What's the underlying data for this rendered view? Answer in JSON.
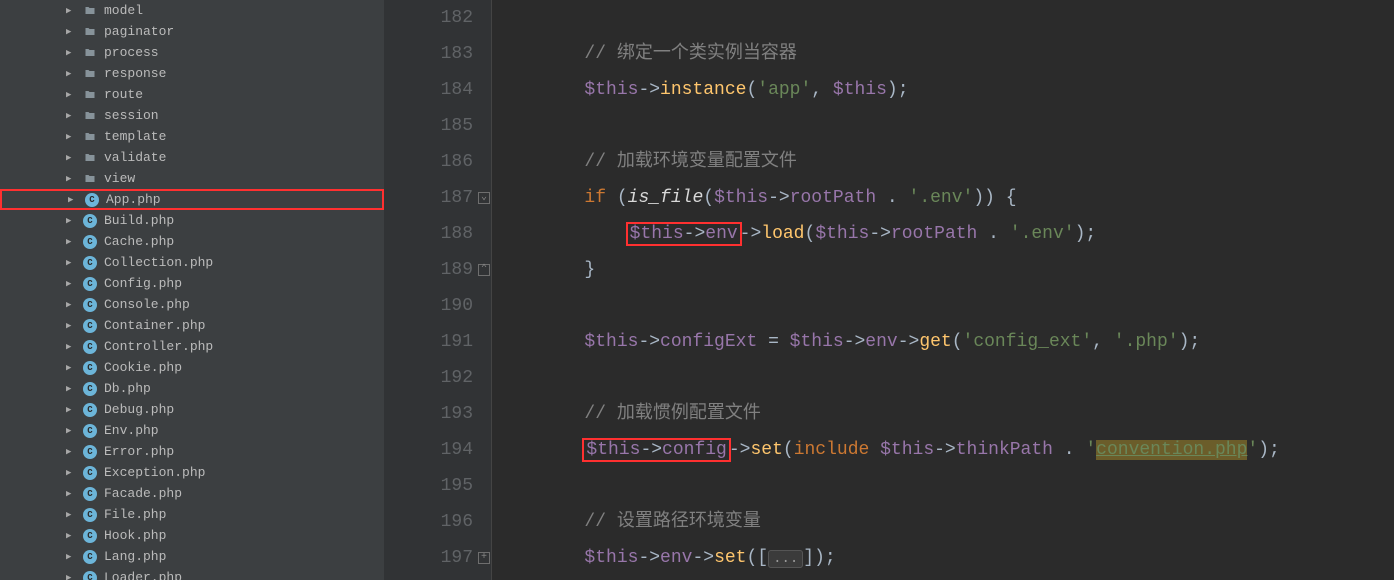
{
  "sidebar": {
    "items": [
      {
        "kind": "folder",
        "label": "model",
        "highlight": false
      },
      {
        "kind": "folder",
        "label": "paginator",
        "highlight": false
      },
      {
        "kind": "folder",
        "label": "process",
        "highlight": false
      },
      {
        "kind": "folder",
        "label": "response",
        "highlight": false
      },
      {
        "kind": "folder",
        "label": "route",
        "highlight": false
      },
      {
        "kind": "folder",
        "label": "session",
        "highlight": false
      },
      {
        "kind": "folder",
        "label": "template",
        "highlight": false
      },
      {
        "kind": "folder",
        "label": "validate",
        "highlight": false
      },
      {
        "kind": "folder",
        "label": "view",
        "highlight": false
      },
      {
        "kind": "php",
        "label": "App.php",
        "highlight": true
      },
      {
        "kind": "php",
        "label": "Build.php",
        "highlight": false
      },
      {
        "kind": "php",
        "label": "Cache.php",
        "highlight": false
      },
      {
        "kind": "php",
        "label": "Collection.php",
        "highlight": false
      },
      {
        "kind": "php",
        "label": "Config.php",
        "highlight": false
      },
      {
        "kind": "php",
        "label": "Console.php",
        "highlight": false
      },
      {
        "kind": "php",
        "label": "Container.php",
        "highlight": false
      },
      {
        "kind": "php",
        "label": "Controller.php",
        "highlight": false
      },
      {
        "kind": "php",
        "label": "Cookie.php",
        "highlight": false
      },
      {
        "kind": "php",
        "label": "Db.php",
        "highlight": false
      },
      {
        "kind": "php",
        "label": "Debug.php",
        "highlight": false
      },
      {
        "kind": "php",
        "label": "Env.php",
        "highlight": false
      },
      {
        "kind": "php",
        "label": "Error.php",
        "highlight": false
      },
      {
        "kind": "php",
        "label": "Exception.php",
        "highlight": false
      },
      {
        "kind": "php",
        "label": "Facade.php",
        "highlight": false
      },
      {
        "kind": "php",
        "label": "File.php",
        "highlight": false
      },
      {
        "kind": "php",
        "label": "Hook.php",
        "highlight": false
      },
      {
        "kind": "php",
        "label": "Lang.php",
        "highlight": false
      },
      {
        "kind": "php",
        "label": "Loader.php",
        "highlight": false
      }
    ]
  },
  "editor": {
    "firstLine": 182,
    "lineNumbers": [
      "182",
      "183",
      "184",
      "185",
      "186",
      "187",
      "188",
      "189",
      "190",
      "191",
      "192",
      "193",
      "194",
      "195",
      "196",
      "197"
    ],
    "foldMarks": {
      "187": "top",
      "189": "bottom",
      "197": "plus"
    },
    "lines": [
      [],
      [
        {
          "cls": "cm",
          "text": "// 绑定一个类实例当容器"
        }
      ],
      [
        {
          "cls": "var",
          "text": "$this"
        },
        {
          "cls": "op",
          "text": "->"
        },
        {
          "cls": "mth",
          "text": "instance"
        },
        {
          "cls": "op",
          "text": "("
        },
        {
          "cls": "str",
          "text": "'app'"
        },
        {
          "cls": "op",
          "text": ", "
        },
        {
          "cls": "var",
          "text": "$this"
        },
        {
          "cls": "op",
          "text": ");"
        }
      ],
      [],
      [
        {
          "cls": "cm",
          "text": "// 加载环境变量配置文件"
        }
      ],
      [
        {
          "cls": "kw",
          "text": "if "
        },
        {
          "cls": "op",
          "text": "("
        },
        {
          "cls": "fnit",
          "text": "is_file"
        },
        {
          "cls": "op",
          "text": "("
        },
        {
          "cls": "var",
          "text": "$this"
        },
        {
          "cls": "op",
          "text": "->"
        },
        {
          "cls": "prop",
          "text": "rootPath"
        },
        {
          "cls": "op",
          "text": " . "
        },
        {
          "cls": "str",
          "text": "'.env'"
        },
        {
          "cls": "op",
          "text": ")) {"
        }
      ],
      [
        {
          "cls": "op",
          "text": "    "
        },
        {
          "redstart": true
        },
        {
          "cls": "var",
          "text": "$this"
        },
        {
          "cls": "op",
          "text": "->"
        },
        {
          "cls": "prop",
          "text": "env"
        },
        {
          "redend": true
        },
        {
          "cls": "op",
          "text": "->"
        },
        {
          "cls": "mth",
          "text": "load"
        },
        {
          "cls": "op",
          "text": "("
        },
        {
          "cls": "var",
          "text": "$this"
        },
        {
          "cls": "op",
          "text": "->"
        },
        {
          "cls": "prop",
          "text": "rootPath"
        },
        {
          "cls": "op",
          "text": " . "
        },
        {
          "cls": "str",
          "text": "'.env'"
        },
        {
          "cls": "op",
          "text": ");"
        }
      ],
      [
        {
          "cls": "op",
          "text": "}"
        }
      ],
      [],
      [
        {
          "cls": "var",
          "text": "$this"
        },
        {
          "cls": "op",
          "text": "->"
        },
        {
          "cls": "prop",
          "text": "configExt"
        },
        {
          "cls": "op",
          "text": " = "
        },
        {
          "cls": "var",
          "text": "$this"
        },
        {
          "cls": "op",
          "text": "->"
        },
        {
          "cls": "prop",
          "text": "env"
        },
        {
          "cls": "op",
          "text": "->"
        },
        {
          "cls": "mth",
          "text": "get"
        },
        {
          "cls": "op",
          "text": "("
        },
        {
          "cls": "str",
          "text": "'config_ext'"
        },
        {
          "cls": "op",
          "text": ", "
        },
        {
          "cls": "str",
          "text": "'.php'"
        },
        {
          "cls": "op",
          "text": ");"
        }
      ],
      [],
      [
        {
          "cls": "cm",
          "text": "// 加载惯例配置文件"
        }
      ],
      [
        {
          "redstart": true
        },
        {
          "cls": "var",
          "text": "$this"
        },
        {
          "cls": "op",
          "text": "->"
        },
        {
          "cls": "prop",
          "text": "config"
        },
        {
          "redend": true
        },
        {
          "cls": "op",
          "text": "->"
        },
        {
          "cls": "mth",
          "text": "set"
        },
        {
          "cls": "op",
          "text": "("
        },
        {
          "cls": "inc",
          "text": "include "
        },
        {
          "cls": "var",
          "text": "$this"
        },
        {
          "cls": "op",
          "text": "->"
        },
        {
          "cls": "prop",
          "text": "thinkPath"
        },
        {
          "cls": "op",
          "text": " . "
        },
        {
          "cls": "str",
          "text": "'"
        },
        {
          "cls": "strhl",
          "text": "convention.php"
        },
        {
          "cls": "str",
          "text": "'"
        },
        {
          "cls": "op",
          "text": ");"
        }
      ],
      [],
      [
        {
          "cls": "cm",
          "text": "// 设置路径环境变量"
        }
      ],
      [
        {
          "cls": "var",
          "text": "$this"
        },
        {
          "cls": "op",
          "text": "->"
        },
        {
          "cls": "prop",
          "text": "env"
        },
        {
          "cls": "op",
          "text": "->"
        },
        {
          "cls": "mth",
          "text": "set"
        },
        {
          "cls": "op",
          "text": "(["
        },
        {
          "fold": true,
          "text": "..."
        },
        {
          "cls": "op",
          "text": "]);"
        }
      ]
    ],
    "indent": "        "
  }
}
